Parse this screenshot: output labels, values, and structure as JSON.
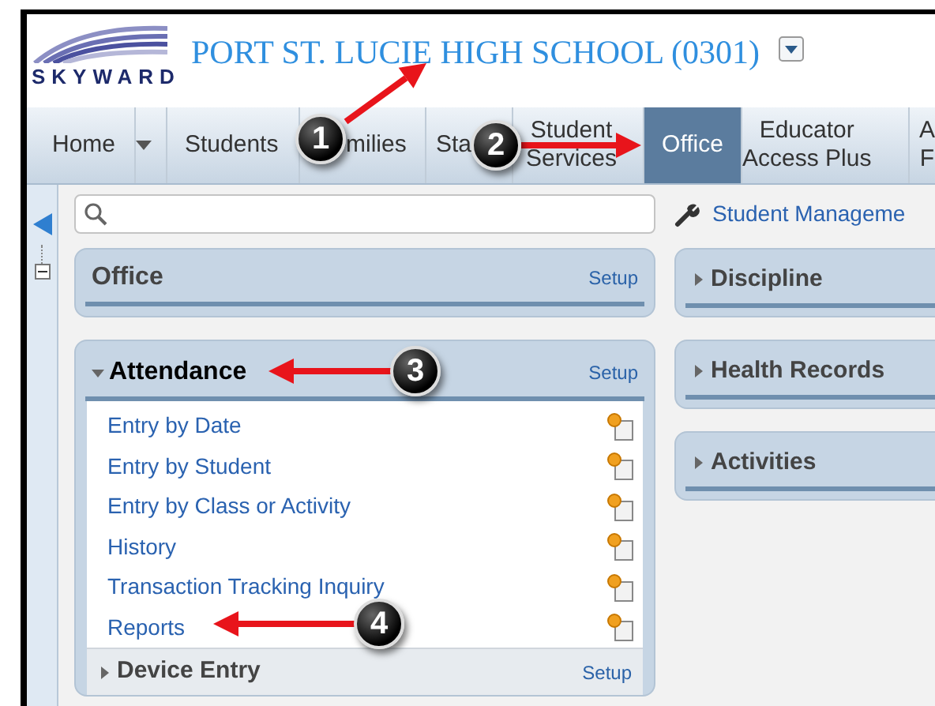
{
  "header": {
    "logo_text": "SKYWARD",
    "title": "PORT ST. LUCIE HIGH SCHOOL (0301)"
  },
  "nav": {
    "tabs": [
      {
        "kind": "text",
        "lines": [
          "Home"
        ],
        "selected": false
      },
      {
        "kind": "caret",
        "selected": false
      },
      {
        "kind": "text",
        "lines": [
          "Students"
        ],
        "selected": false
      },
      {
        "kind": "text",
        "lines": [
          "milies"
        ],
        "selected": false
      },
      {
        "kind": "text",
        "lines": [
          "Sta"
        ],
        "selected": false
      },
      {
        "kind": "text",
        "lines": [
          "Student",
          "Services"
        ],
        "selected": false
      },
      {
        "kind": "text",
        "lines": [
          "Office"
        ],
        "selected": true
      },
      {
        "kind": "text",
        "lines": [
          "Educator",
          "Access Plus"
        ],
        "selected": false
      },
      {
        "kind": "text",
        "lines": [
          "A",
          "F"
        ],
        "selected": false
      }
    ]
  },
  "toolbar": {
    "link": "Student Manageme"
  },
  "left_panels": [
    {
      "kind": "plain",
      "title": "Office",
      "setup": "Setup"
    },
    {
      "kind": "group",
      "title": "Attendance",
      "setup": "Setup",
      "expanded": true,
      "items": [
        "Entry by Date",
        "Entry by Student",
        "Entry by Class or Activity",
        "History",
        "Transaction Tracking Inquiry",
        "Reports"
      ],
      "sub_sections": [
        {
          "title": "Device Entry",
          "setup": "Setup",
          "expanded": false
        }
      ]
    }
  ],
  "right_panels": [
    {
      "title": "Discipline",
      "expanded": false
    },
    {
      "title": "Health Records",
      "expanded": false
    },
    {
      "title": "Activities",
      "expanded": false
    }
  ],
  "annotations": [
    {
      "number": "1"
    },
    {
      "number": "2"
    },
    {
      "number": "3"
    },
    {
      "number": "4"
    }
  ]
}
